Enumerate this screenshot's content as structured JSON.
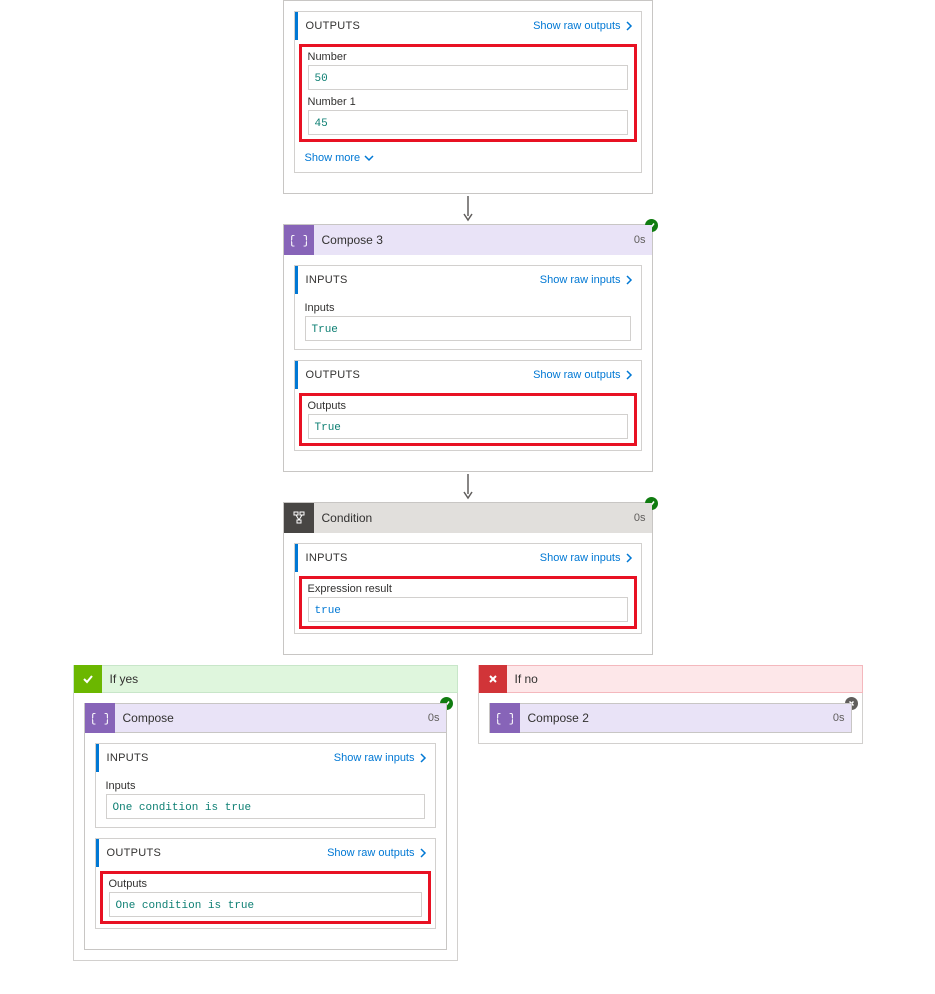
{
  "labels": {
    "outputs_section": "OUTPUTS",
    "inputs_section": "INPUTS",
    "show_raw_outputs": "Show raw outputs",
    "show_raw_inputs": "Show raw inputs",
    "show_more": "Show more"
  },
  "top_card": {
    "outputs": {
      "fields": [
        {
          "label": "Number",
          "value": "50"
        },
        {
          "label": "Number 1",
          "value": "45"
        }
      ]
    }
  },
  "compose3": {
    "title": "Compose 3",
    "duration": "0s",
    "inputs": {
      "label": "Inputs",
      "value": "True"
    },
    "outputs": {
      "label": "Outputs",
      "value": "True"
    }
  },
  "condition": {
    "title": "Condition",
    "duration": "0s",
    "inputs": {
      "label": "Expression result",
      "value": "true"
    }
  },
  "branches": {
    "yes": {
      "label": "If yes",
      "compose": {
        "title": "Compose",
        "duration": "0s",
        "inputs": {
          "label": "Inputs",
          "value": "One condition is true"
        },
        "outputs": {
          "label": "Outputs",
          "value": "One condition is true"
        }
      }
    },
    "no": {
      "label": "If no",
      "compose2": {
        "title": "Compose 2",
        "duration": "0s"
      }
    }
  }
}
